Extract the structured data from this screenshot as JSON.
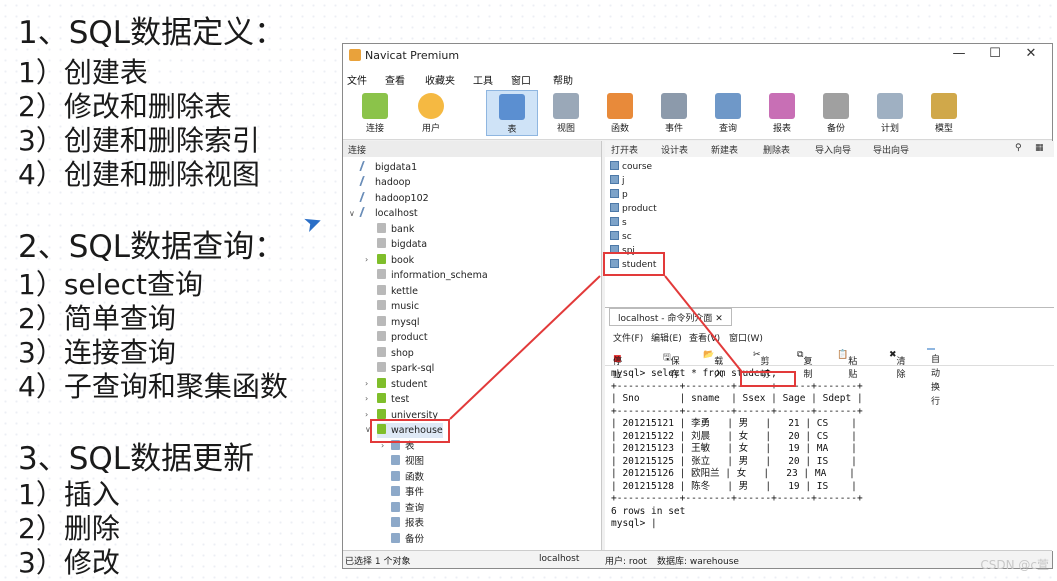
{
  "notes": [
    {
      "text": "1、SQL数据定义：",
      "h": true
    },
    {
      "text": "1）创建表"
    },
    {
      "text": "2）修改和删除表"
    },
    {
      "text": "3）创建和删除索引"
    },
    {
      "text": "4）创建和删除视图"
    },
    {
      "text": "2、SQL数据查询：",
      "h": true
    },
    {
      "text": "1）select查询"
    },
    {
      "text": "2）简单查询"
    },
    {
      "text": "3）连接查询"
    },
    {
      "text": "4）子查询和聚集函数"
    },
    {
      "text": "3、SQL数据更新",
      "h": true
    },
    {
      "text": "1）插入"
    },
    {
      "text": "2）删除"
    },
    {
      "text": "3）修改"
    }
  ],
  "window": {
    "title": "Navicat Premium"
  },
  "menu": [
    "文件",
    "查看",
    "收藏夹",
    "工具",
    "窗口",
    "帮助"
  ],
  "toolbar": [
    "连接",
    "用户",
    "表",
    "视图",
    "函数",
    "事件",
    "查询",
    "报表",
    "备份",
    "计划",
    "模型"
  ],
  "left_header": "连接",
  "tree": [
    "bigdata1",
    "hadoop",
    "hadoop102",
    "localhost",
    "bank",
    "bigdata",
    "book",
    "information_schema",
    "kettle",
    "music",
    "mysql",
    "product",
    "shop",
    "spark-sql",
    "student",
    "test",
    "university",
    "warehouse",
    "表",
    "视图",
    "函数",
    "事件",
    "查询",
    "报表",
    "备份"
  ],
  "obj_toolbar": [
    "打开表",
    "设计表",
    "新建表",
    "删除表",
    "导入向导",
    "导出向导"
  ],
  "tables": [
    "course",
    "j",
    "p",
    "product",
    "s",
    "sc",
    "spj",
    "student"
  ],
  "console": {
    "tab": "localhost - 命令列介面",
    "menu": [
      "文件(F)",
      "编辑(E)",
      "查看(V)",
      "窗口(W)"
    ],
    "tools": [
      "停止",
      "保存",
      "载入",
      "剪切",
      "复制",
      "粘贴",
      "清除",
      "自动换行"
    ],
    "lines": [
      "mysql> select * from student;",
      "+-----------+--------+------+------+-------+",
      "| Sno       | sname  | Ssex | Sage | Sdept |",
      "+-----------+--------+------+------+-------+",
      "| 201215121 | 李勇   | 男   |   21 | CS    |",
      "| 201215122 | 刘晨   | 女   |   20 | CS    |",
      "| 201215123 | 王敏   | 女   |   19 | MA    |",
      "| 201215125 | 张立   | 男   |   20 | IS    |",
      "| 201215126 | 欧阳兰 | 女   |   23 | MA    |",
      "| 201215128 | 陈冬   | 男   |   19 | IS    |",
      "+-----------+--------+------+------+-------+",
      "6 rows in set",
      "",
      "mysql> |"
    ]
  },
  "status": [
    "已选择 1 个对象",
    "localhost",
    "用户: root",
    "数据库: warehouse"
  ],
  "watermark": "CSDN @c萱"
}
